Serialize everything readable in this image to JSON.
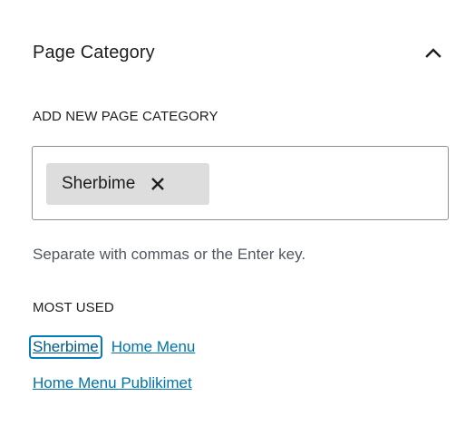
{
  "panel": {
    "title": "Page Category",
    "toggle_icon": "chevron-up-icon"
  },
  "add_new": {
    "label": "ADD NEW PAGE CATEGORY",
    "tokens": [
      {
        "label": "Sherbime",
        "remove_icon": "close-icon"
      }
    ],
    "help_text": "Separate with commas or the Enter key."
  },
  "most_used": {
    "label": "MOST USED",
    "tags": [
      {
        "label": "Sherbime",
        "focused": true
      },
      {
        "label": "Home Menu",
        "focused": false
      },
      {
        "label": "Home Menu Publikimet",
        "focused": false
      }
    ]
  },
  "colors": {
    "link": "#0073aa",
    "focus_ring": "#007cba",
    "token_bg": "#dddddd",
    "help_text": "#50575e"
  }
}
